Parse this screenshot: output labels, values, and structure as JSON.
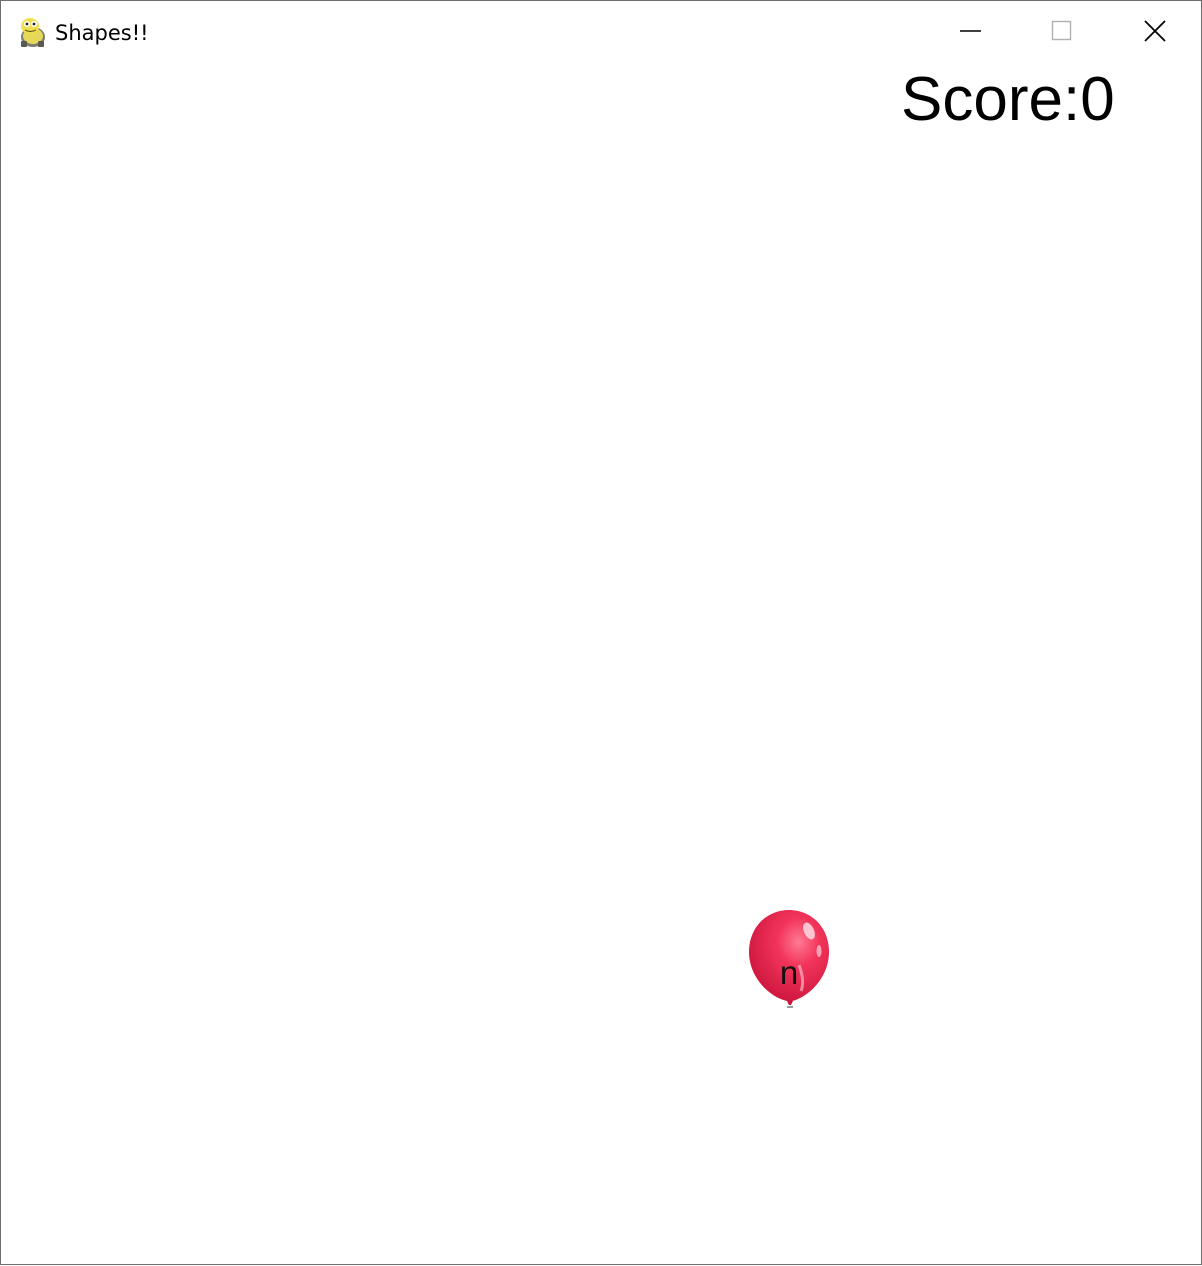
{
  "window": {
    "title": "Shapes!!",
    "app_icon": "pygame-snake-icon",
    "controls": {
      "minimize_icon": "minimize-icon",
      "maximize_icon": "maximize-icon",
      "close_icon": "close-icon"
    }
  },
  "game": {
    "score_label": "Score:",
    "score_value": "0",
    "balloons": [
      {
        "letter": "n",
        "color": "#e8264f"
      }
    ]
  },
  "colors": {
    "background": "#ffffff",
    "balloon": "#e8264f",
    "text": "#000000"
  }
}
